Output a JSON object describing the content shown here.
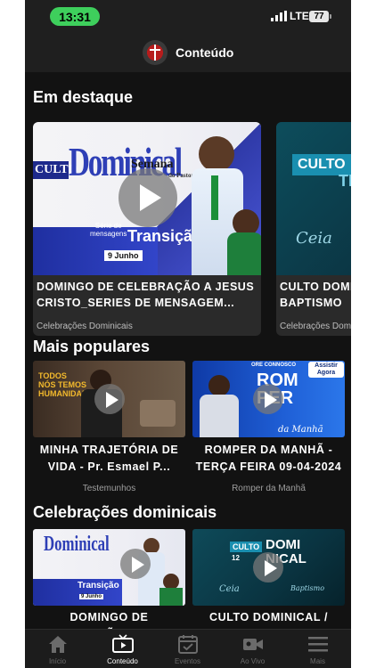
{
  "status_bar": {
    "time": "13:31",
    "network": "LTE",
    "battery": "77"
  },
  "header": {
    "title": "Conteúdo",
    "logo_icon": "church-logo-icon"
  },
  "featured": {
    "title": "Em destaque",
    "items": [
      {
        "title": "DOMINGO DE CELEBRAÇÃO A JESUS\nCRISTO_SERIES DE MENSAGEM...",
        "category": "Celebrações Dominicais",
        "thumb_text": {
          "brand": "CULTO",
          "big": "Dominical",
          "week": "Semana",
          "week_sub": "do Pastor",
          "series": "Série de\nmensagens",
          "theme": "Transição",
          "date": "9 Junho"
        }
      },
      {
        "title": "CULTO DOMINICAL /\nBAPTISMO",
        "category": "Celebrações Dominicais",
        "thumb_text": {
          "brand": "CULTO",
          "big": "TI",
          "script": "Ceia"
        }
      }
    ]
  },
  "popular": {
    "title": "Mais populares",
    "items": [
      {
        "title": "MINHA TRAJETÓRIA DE\nVIDA - Pr. Esmael P...",
        "category": "Testemunhos",
        "thumb_text": {
          "line1": "TODOS",
          "line2": "NÓS TEMOS",
          "line3": "HUMANIDADE"
        }
      },
      {
        "title": "ROMPER DA MANHÃ -\nTERÇA FEIRA 09-04-2024",
        "category": "Romper da Manhã",
        "thumb_text": {
          "badge": "Assistir\nAgora",
          "top": "ORE CONNOSCO",
          "big": "ROM\nPER",
          "script": "da Manhã"
        }
      }
    ]
  },
  "sunday": {
    "title": "Celebrações dominicais",
    "items": [
      {
        "title": "DOMINGO DE\nCELEBRAÇÃO A JESUS",
        "thumb_text": {
          "big": "Dominical",
          "theme": "Transição",
          "date": "9 Junho"
        }
      },
      {
        "title": "CULTO DOMINICAL /\nSANTA CEIA / BAPTISMO",
        "thumb_text": {
          "brand": "CULTO",
          "day": "12",
          "big": "DOMI\nNICAL",
          "script": "Ceia",
          "script2": "Baptismo"
        }
      }
    ]
  },
  "bottom_nav": [
    {
      "label": "Início",
      "icon": "home-icon",
      "active": false
    },
    {
      "label": "Conteúdo",
      "icon": "tv-icon",
      "active": true
    },
    {
      "label": "Eventos",
      "icon": "calendar-check-icon",
      "active": false
    },
    {
      "label": "Ao Vivo",
      "icon": "video-camera-icon",
      "active": false
    },
    {
      "label": "Mais",
      "icon": "menu-icon",
      "active": false
    }
  ],
  "colors": {
    "accent_green": "#3ecf5c",
    "background": "#121212",
    "card": "#2a2a2a"
  }
}
